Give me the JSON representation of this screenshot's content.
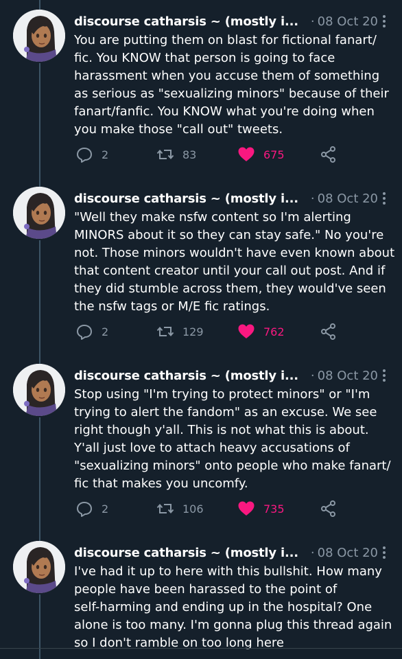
{
  "theme": {
    "background": "#15202b",
    "muted_text": "#8b98a5",
    "like_pink": "#f91880"
  },
  "tweets": [
    {
      "author": "discourse catharsis ~ (mostly i...",
      "separator": "·",
      "date": "08 Oct 20",
      "text": "You are putting them on blast for fictional fanart/\nfic. You KNOW that person is going to face\nharassment when you accuse them of something\nas serious as \"sexualizing minors\" because of their\nfanart/fanfic. You KNOW what you're doing when\nyou make those \"call out\" tweets.",
      "replies": "2",
      "retweets": "83",
      "likes": "675"
    },
    {
      "author": "discourse catharsis ~ (mostly i...",
      "separator": "·",
      "date": "08 Oct 20",
      "text": "\"Well they make nsfw content so I'm alerting\nMINORS about it so they can stay safe.\" No you're\nnot. Those minors wouldn't have even known about\nthat content creator until your call out post. And if\nthey did stumble across them, they would've seen\nthe nsfw tags or M/E fic ratings.",
      "replies": "2",
      "retweets": "129",
      "likes": "762"
    },
    {
      "author": "discourse catharsis ~ (mostly i...",
      "separator": "·",
      "date": "08 Oct 20",
      "text": "Stop using \"I'm trying to protect minors\" or \"I'm\ntrying to alert the fandom\" as an excuse. We see\nright though y'all. This is not what this is about.\nY'all just love to attach heavy accusations of\n\"sexualizing minors\" onto people who make fanart/\nfic that makes you uncomfy.",
      "replies": "2",
      "retweets": "106",
      "likes": "735"
    },
    {
      "author": "discourse catharsis ~ (mostly i...",
      "separator": "·",
      "date": "08 Oct 20",
      "text": "I've had it up to here with this bullshit. How many\npeople have been harassed to the point of\nself-harming and ending up in the hospital? One\nalone is too many. I'm gonna plug this thread again\nso I don't ramble on too long here"
    }
  ]
}
